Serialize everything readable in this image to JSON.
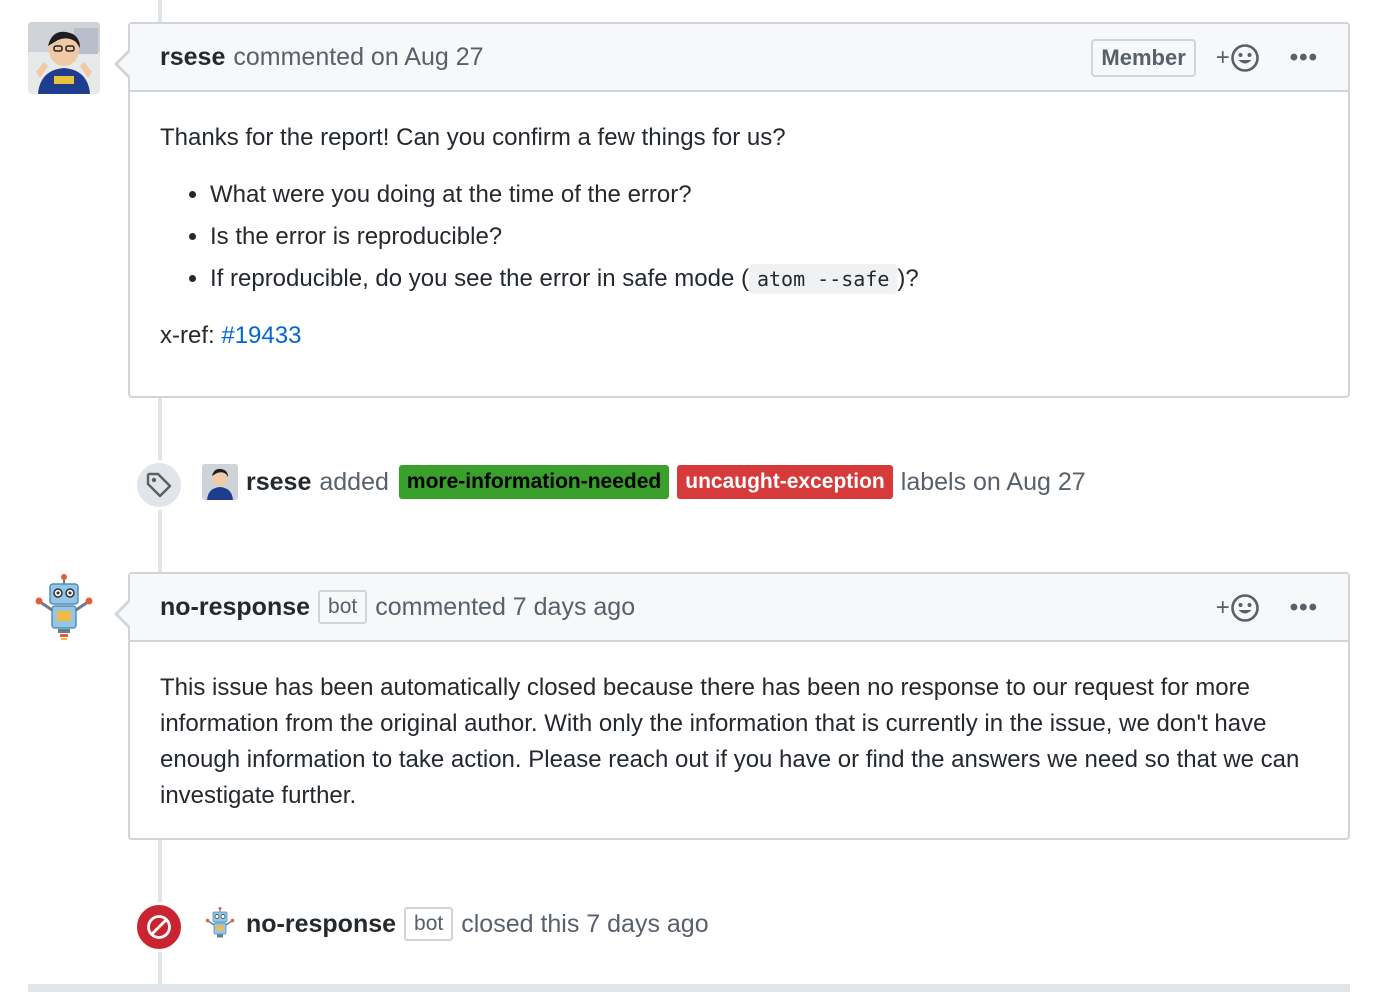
{
  "comment1": {
    "author": "rsese",
    "action": "commented on Aug 27",
    "member_label": "Member",
    "reaction_plus": "+",
    "more": "•••",
    "intro": "Thanks for the report! Can you confirm a few things for us?",
    "bullets": [
      "What were you doing at the time of the error?",
      "Is the error is reproducible?"
    ],
    "bullet3_pre": "If reproducible, do you see the error in safe mode (",
    "bullet3_code": "atom --safe",
    "bullet3_post": ")?",
    "xref_label": "x-ref:",
    "xref_link": "#19433"
  },
  "label_event": {
    "author": "rsese",
    "added": "added",
    "labels": [
      {
        "name": "more-information-needed",
        "color": "#38a02b",
        "text_color": "#000000"
      },
      {
        "name": "uncaught-exception",
        "color": "#d73a3a",
        "text_color": "#ffffff"
      }
    ],
    "suffix": "labels on Aug 27"
  },
  "comment2": {
    "author": "no-response",
    "bot": "bot",
    "action": "commented 7 days ago",
    "reaction_plus": "+",
    "more": "•••",
    "body": "This issue has been automatically closed because there has been no response to our request for more information from the original author. With only the information that is currently in the issue, we don't have enough information to take action. Please reach out if you have or find the answers we need so that we can investigate further."
  },
  "close_event": {
    "author": "no-response",
    "bot": "bot",
    "action": "closed this 7 days ago",
    "badge_color": "#cb2431"
  },
  "icons": [
    "tag-icon",
    "smiley-icon",
    "kebab-icon",
    "closed-icon",
    "robot-avatar"
  ]
}
